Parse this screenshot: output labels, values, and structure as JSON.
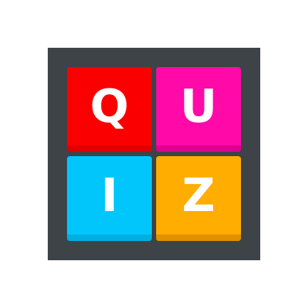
{
  "board": {
    "background": "#3d4347"
  },
  "tiles": [
    {
      "letter": "Q",
      "color": "#fb0000",
      "shade": "#e00000"
    },
    {
      "letter": "U",
      "color": "#ff0aa8",
      "shade": "#e0008f"
    },
    {
      "letter": "I",
      "color": "#00c6fb",
      "shade": "#00aee0"
    },
    {
      "letter": "Z",
      "color": "#ffad00",
      "shade": "#e09000"
    }
  ]
}
